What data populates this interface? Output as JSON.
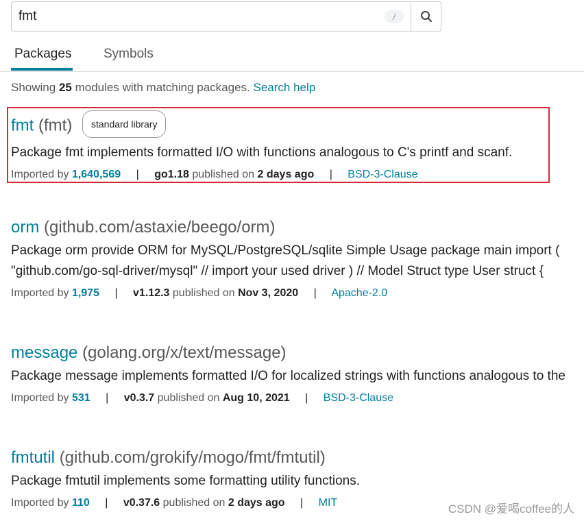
{
  "search": {
    "value": "fmt",
    "shortcut_hint": "/"
  },
  "tabs": [
    {
      "label": "Packages",
      "active": true
    },
    {
      "label": "Symbols",
      "active": false
    }
  ],
  "summary": {
    "prefix": "Showing",
    "count": "25",
    "suffix": "modules with matching packages.",
    "help_link": "Search help"
  },
  "results": [
    {
      "name": "fmt",
      "path": "(fmt)",
      "badge": "standard library",
      "synopsis_lines": [
        "Package fmt implements formatted I/O with functions analogous to C's printf and scanf."
      ],
      "imported_by_label": "Imported by",
      "imported_by": "1,640,569",
      "version": "go1.18",
      "published_label": "published on",
      "published": "2 days ago",
      "license": "BSD-3-Clause"
    },
    {
      "name": "orm",
      "path": "(github.com/astaxie/beego/orm)",
      "synopsis_lines": [
        "Package orm provide ORM for MySQL/PostgreSQL/sqlite Simple Usage package main import (",
        "\"github.com/go-sql-driver/mysql\" // import your used driver ) // Model Struct type User struct {"
      ],
      "imported_by_label": "Imported by",
      "imported_by": "1,975",
      "version": "v1.12.3",
      "published_label": "published on",
      "published": "Nov 3, 2020",
      "license": "Apache-2.0"
    },
    {
      "name": "message",
      "path": "(golang.org/x/text/message)",
      "synopsis_lines": [
        "Package message implements formatted I/O for localized strings with functions analogous to the"
      ],
      "imported_by_label": "Imported by",
      "imported_by": "531",
      "version": "v0.3.7",
      "published_label": "published on",
      "published": "Aug 10, 2021",
      "license": "BSD-3-Clause"
    },
    {
      "name": "fmtutil",
      "path": "(github.com/grokify/mogo/fmt/fmtutil)",
      "synopsis_lines": [
        "Package fmtutil implements some formatting utility functions."
      ],
      "imported_by_label": "Imported by",
      "imported_by": "110",
      "version": "v0.37.6",
      "published_label": "published on",
      "published": "2 days ago",
      "license": "MIT"
    }
  ],
  "watermark": "CSDN @爱喝coffee的人",
  "colors": {
    "link": "#007d9c",
    "highlight_border": "#d22b34",
    "text": "#202224",
    "muted": "#555759"
  }
}
